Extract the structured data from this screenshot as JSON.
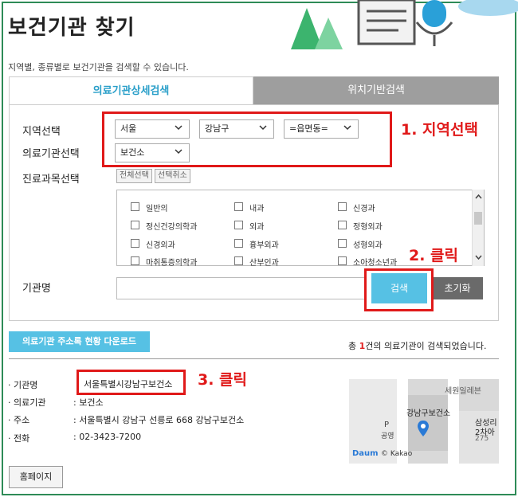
{
  "page": {
    "title": "보건기관 찾기",
    "subtitle": "지역별, 종류별로 보건기관을 검색할 수 있습니다."
  },
  "tabs": [
    {
      "label": "의료기관상세검색",
      "active": true
    },
    {
      "label": "위치기반검색",
      "active": false
    }
  ],
  "form": {
    "region_label": "지역선택",
    "type_label": "의료기관선택",
    "dept_label": "진료과목선택",
    "name_label": "기관명",
    "region_sido": "서울",
    "region_sigungu": "강남구",
    "region_dong": "=읍면동=",
    "inst_type": "보건소",
    "select_all_label": "전체선택",
    "deselect_label": "선택취소",
    "search_label": "검색",
    "reset_label": "초기화"
  },
  "departments": [
    [
      "일반의",
      "내과",
      "신경과"
    ],
    [
      "정신건강의학과",
      "외과",
      "정형외과"
    ],
    [
      "신경외과",
      "흉부외과",
      "성형외과"
    ],
    [
      "마취통증의학과",
      "산부인과",
      "소아청소년과"
    ]
  ],
  "download_label": "의료기관 주소록 현황 다운로드",
  "result": {
    "prefix": "총 ",
    "count": "1",
    "suffix": "건의 의료기관이 검색되었습니다."
  },
  "detail": {
    "rows": [
      {
        "label": "· 기관명",
        "value": ""
      },
      {
        "label": "· 의료기관",
        "value": ": 보건소"
      },
      {
        "label": "· 주소",
        "value": ": 서울특별시 강남구 선릉로 668 강남구보건소"
      },
      {
        "label": "· 전화",
        "value": ": 02-3423-7200"
      }
    ],
    "institution_name": "서울특별시강남구보건소"
  },
  "map": {
    "place": "강남구보건소",
    "park": "P",
    "park_label": "공영",
    "road": "세원일레븐",
    "bldg1": "삼성리",
    "bldg2": "2차아",
    "bldg3": "275",
    "brand": "Daum",
    "kakao": "© Kakao"
  },
  "home_label": "홈페이지",
  "annotations": {
    "step1": "1. 지역선택",
    "step2": "2. 클릭",
    "step3": "3. 클릭"
  },
  "colors": {
    "accent": "#56c1e4",
    "annotation": "#e01919",
    "frame": "#2e8b57"
  }
}
